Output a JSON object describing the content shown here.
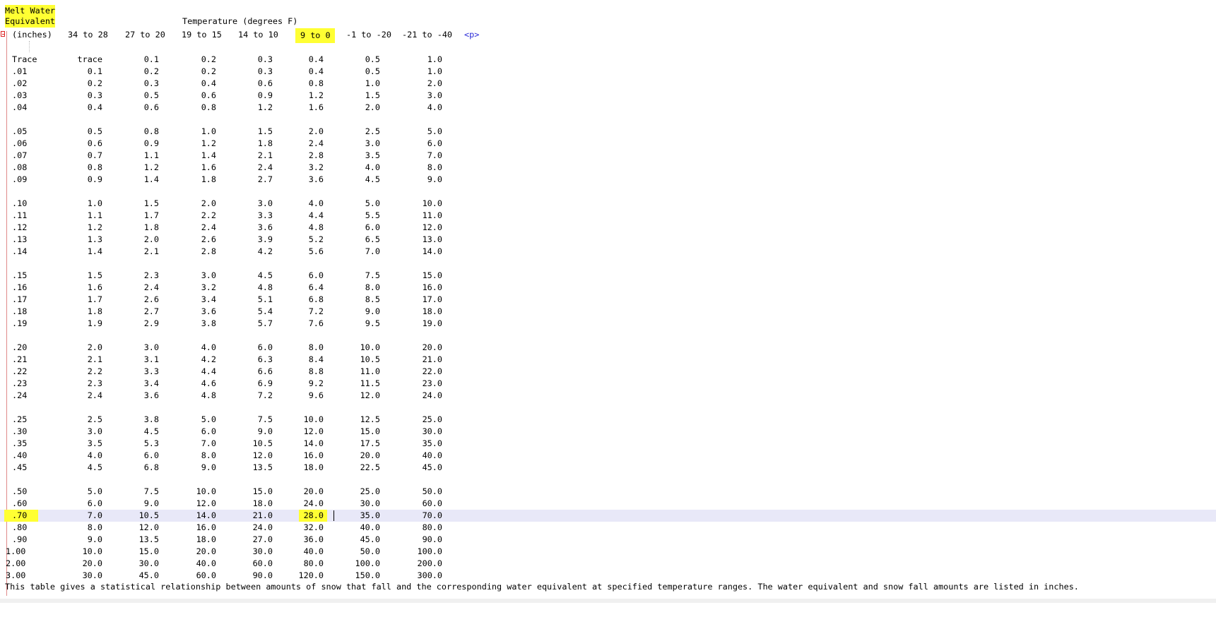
{
  "editor": {
    "title_line1": "Melt Water",
    "title_line2": "Equivalent",
    "temperature_header": "Temperature (degrees F)",
    "units_label": "(inches)",
    "columns": [
      "34 to 28",
      "27 to 20",
      "19 to 15",
      "14 to 10",
      "9 to 0",
      "-1 to -20",
      "-21 to -40"
    ],
    "highlighted_column_index": 4,
    "p_tag": "<p>",
    "footer": "This table gives a statistical relationship between amounts of snow that fall and the corresponding water equivalent at specified temperature ranges. The water equivalent and snow fall amounts are listed in inches.",
    "highlight_color": "#ffff33",
    "current_line_color": "#e8e8f8",
    "current_row_label": ".70"
  },
  "rows": [
    {
      "label": "Trace",
      "values": [
        "trace",
        "0.1",
        "0.2",
        "0.3",
        "0.4",
        "0.5",
        "1.0"
      ]
    },
    {
      "label": ".01",
      "values": [
        "0.1",
        "0.2",
        "0.2",
        "0.3",
        "0.4",
        "0.5",
        "1.0"
      ]
    },
    {
      "label": ".02",
      "values": [
        "0.2",
        "0.3",
        "0.4",
        "0.6",
        "0.8",
        "1.0",
        "2.0"
      ]
    },
    {
      "label": ".03",
      "values": [
        "0.3",
        "0.5",
        "0.6",
        "0.9",
        "1.2",
        "1.5",
        "3.0"
      ]
    },
    {
      "label": ".04",
      "values": [
        "0.4",
        "0.6",
        "0.8",
        "1.2",
        "1.6",
        "2.0",
        "4.0"
      ]
    },
    {
      "blank": true
    },
    {
      "label": ".05",
      "values": [
        "0.5",
        "0.8",
        "1.0",
        "1.5",
        "2.0",
        "2.5",
        "5.0"
      ]
    },
    {
      "label": ".06",
      "values": [
        "0.6",
        "0.9",
        "1.2",
        "1.8",
        "2.4",
        "3.0",
        "6.0"
      ]
    },
    {
      "label": ".07",
      "values": [
        "0.7",
        "1.1",
        "1.4",
        "2.1",
        "2.8",
        "3.5",
        "7.0"
      ]
    },
    {
      "label": ".08",
      "values": [
        "0.8",
        "1.2",
        "1.6",
        "2.4",
        "3.2",
        "4.0",
        "8.0"
      ]
    },
    {
      "label": ".09",
      "values": [
        "0.9",
        "1.4",
        "1.8",
        "2.7",
        "3.6",
        "4.5",
        "9.0"
      ]
    },
    {
      "blank": true
    },
    {
      "label": ".10",
      "values": [
        "1.0",
        "1.5",
        "2.0",
        "3.0",
        "4.0",
        "5.0",
        "10.0"
      ]
    },
    {
      "label": ".11",
      "values": [
        "1.1",
        "1.7",
        "2.2",
        "3.3",
        "4.4",
        "5.5",
        "11.0"
      ]
    },
    {
      "label": ".12",
      "values": [
        "1.2",
        "1.8",
        "2.4",
        "3.6",
        "4.8",
        "6.0",
        "12.0"
      ]
    },
    {
      "label": ".13",
      "values": [
        "1.3",
        "2.0",
        "2.6",
        "3.9",
        "5.2",
        "6.5",
        "13.0"
      ]
    },
    {
      "label": ".14",
      "values": [
        "1.4",
        "2.1",
        "2.8",
        "4.2",
        "5.6",
        "7.0",
        "14.0"
      ]
    },
    {
      "blank": true
    },
    {
      "label": ".15",
      "values": [
        "1.5",
        "2.3",
        "3.0",
        "4.5",
        "6.0",
        "7.5",
        "15.0"
      ]
    },
    {
      "label": ".16",
      "values": [
        "1.6",
        "2.4",
        "3.2",
        "4.8",
        "6.4",
        "8.0",
        "16.0"
      ]
    },
    {
      "label": ".17",
      "values": [
        "1.7",
        "2.6",
        "3.4",
        "5.1",
        "6.8",
        "8.5",
        "17.0"
      ]
    },
    {
      "label": ".18",
      "values": [
        "1.8",
        "2.7",
        "3.6",
        "5.4",
        "7.2",
        "9.0",
        "18.0"
      ]
    },
    {
      "label": ".19",
      "values": [
        "1.9",
        "2.9",
        "3.8",
        "5.7",
        "7.6",
        "9.5",
        "19.0"
      ]
    },
    {
      "blank": true
    },
    {
      "label": ".20",
      "values": [
        "2.0",
        "3.0",
        "4.0",
        "6.0",
        "8.0",
        "10.0",
        "20.0"
      ]
    },
    {
      "label": ".21",
      "values": [
        "2.1",
        "3.1",
        "4.2",
        "6.3",
        "8.4",
        "10.5",
        "21.0"
      ]
    },
    {
      "label": ".22",
      "values": [
        "2.2",
        "3.3",
        "4.4",
        "6.6",
        "8.8",
        "11.0",
        "22.0"
      ]
    },
    {
      "label": ".23",
      "values": [
        "2.3",
        "3.4",
        "4.6",
        "6.9",
        "9.2",
        "11.5",
        "23.0"
      ]
    },
    {
      "label": ".24",
      "values": [
        "2.4",
        "3.6",
        "4.8",
        "7.2",
        "9.6",
        "12.0",
        "24.0"
      ]
    },
    {
      "blank": true
    },
    {
      "label": ".25",
      "values": [
        "2.5",
        "3.8",
        "5.0",
        "7.5",
        "10.0",
        "12.5",
        "25.0"
      ]
    },
    {
      "label": ".30",
      "values": [
        "3.0",
        "4.5",
        "6.0",
        "9.0",
        "12.0",
        "15.0",
        "30.0"
      ]
    },
    {
      "label": ".35",
      "values": [
        "3.5",
        "5.3",
        "7.0",
        "10.5",
        "14.0",
        "17.5",
        "35.0"
      ]
    },
    {
      "label": ".40",
      "values": [
        "4.0",
        "6.0",
        "8.0",
        "12.0",
        "16.0",
        "20.0",
        "40.0"
      ]
    },
    {
      "label": ".45",
      "values": [
        "4.5",
        "6.8",
        "9.0",
        "13.5",
        "18.0",
        "22.5",
        "45.0"
      ]
    },
    {
      "blank": true
    },
    {
      "label": ".50",
      "values": [
        "5.0",
        "7.5",
        "10.0",
        "15.0",
        "20.0",
        "25.0",
        "50.0"
      ]
    },
    {
      "label": ".60",
      "values": [
        "6.0",
        "9.0",
        "12.0",
        "18.0",
        "24.0",
        "30.0",
        "60.0"
      ]
    },
    {
      "label": ".70",
      "values": [
        "7.0",
        "10.5",
        "14.0",
        "21.0",
        "28.0",
        "35.0",
        "70.0"
      ],
      "current": true
    },
    {
      "label": ".80",
      "values": [
        "8.0",
        "12.0",
        "16.0",
        "24.0",
        "32.0",
        "40.0",
        "80.0"
      ]
    },
    {
      "label": ".90",
      "values": [
        "9.0",
        "13.5",
        "18.0",
        "27.0",
        "36.0",
        "45.0",
        "90.0"
      ]
    },
    {
      "label": "1.00",
      "values": [
        "10.0",
        "15.0",
        "20.0",
        "30.0",
        "40.0",
        "50.0",
        "100.0"
      ]
    },
    {
      "label": "2.00",
      "values": [
        "20.0",
        "30.0",
        "40.0",
        "60.0",
        "80.0",
        "100.0",
        "200.0"
      ]
    },
    {
      "label": "3.00",
      "values": [
        "30.0",
        "45.0",
        "60.0",
        "90.0",
        "120.0",
        "150.0",
        "300.0"
      ]
    }
  ]
}
